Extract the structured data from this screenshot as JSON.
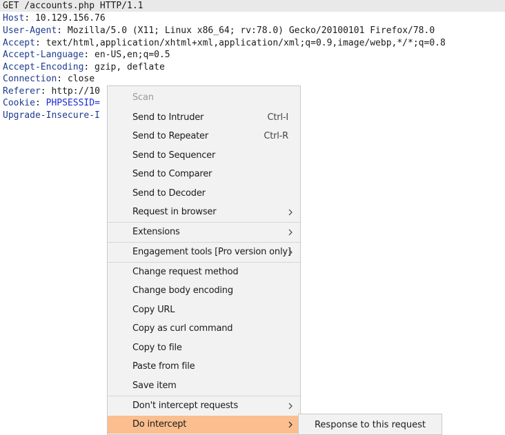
{
  "request": {
    "request_line": "GET /accounts.php HTTP/1.1",
    "headers": [
      {
        "name": "Host",
        "value": " 10.129.156.76"
      },
      {
        "name": "User-Agent",
        "value": " Mozilla/5.0 (X11; Linux x86_64; rv:78.0) Gecko/20100101 Firefox/78.0"
      },
      {
        "name": "Accept",
        "value": " text/html,application/xhtml+xml,application/xml;q=0.9,image/webp,*/*;q=0.8"
      },
      {
        "name": "Accept-Language",
        "value": " en-US,en;q=0.5"
      },
      {
        "name": "Accept-Encoding",
        "value": " gzip, deflate"
      },
      {
        "name": "Connection",
        "value": " close"
      },
      {
        "name": "Referer",
        "value": " http://10"
      },
      {
        "name": "Cookie",
        "value": " PHPSESSID="
      },
      {
        "name": "Upgrade-Insecure-I",
        "value": ""
      }
    ]
  },
  "context_menu": {
    "items": [
      {
        "label": "Scan"
      },
      {
        "label": "Send to Intruder",
        "shortcut": "Ctrl-I"
      },
      {
        "label": "Send to Repeater",
        "shortcut": "Ctrl-R"
      },
      {
        "label": "Send to Sequencer"
      },
      {
        "label": "Send to Comparer"
      },
      {
        "label": "Send to Decoder"
      },
      {
        "label": "Request in browser"
      },
      {
        "label": "Extensions"
      },
      {
        "label": "Engagement tools [Pro version only]"
      },
      {
        "label": "Change request method"
      },
      {
        "label": "Change body encoding"
      },
      {
        "label": "Copy URL"
      },
      {
        "label": "Copy as curl command"
      },
      {
        "label": "Copy to file"
      },
      {
        "label": "Paste from file"
      },
      {
        "label": "Save item"
      },
      {
        "label": "Don't intercept requests"
      },
      {
        "label": "Do intercept"
      }
    ]
  },
  "submenu": {
    "items": [
      {
        "label": "Response to this request"
      }
    ]
  },
  "colors": {
    "highlight": "#fbbe8e",
    "header_name": "#1d3b8f",
    "cookie_name": "#1c2bd8"
  }
}
